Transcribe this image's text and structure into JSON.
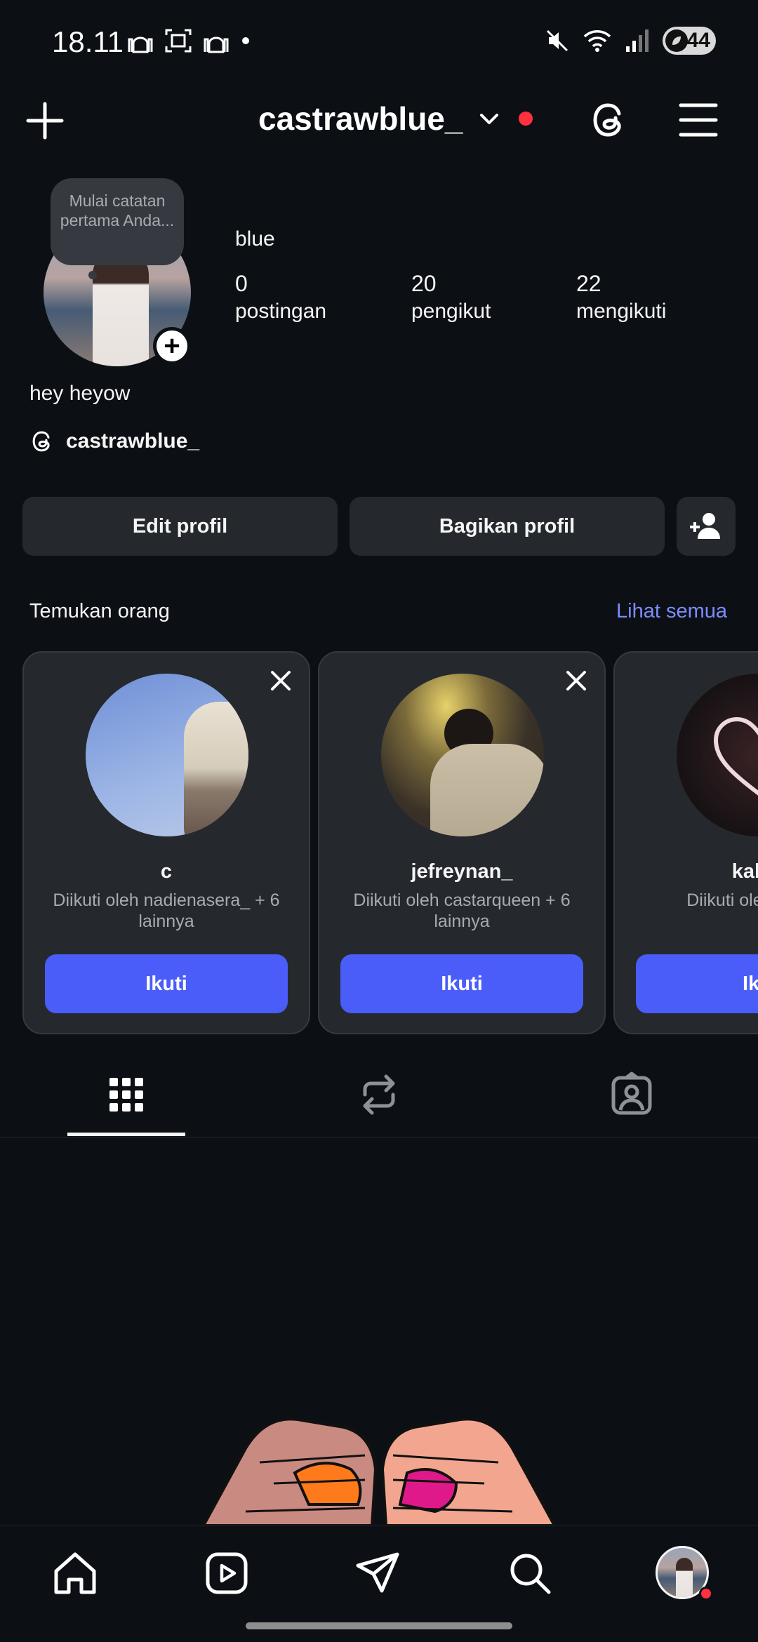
{
  "status_bar": {
    "time": "18.11",
    "battery": "44"
  },
  "header": {
    "username": "castrawblue_"
  },
  "profile": {
    "note": "Mulai catatan pertama Anda...",
    "display_name": "blue",
    "stats": [
      {
        "value": "0",
        "label": "postingan"
      },
      {
        "value": "20",
        "label": "pengikut"
      },
      {
        "value": "22",
        "label": "mengikuti"
      }
    ],
    "bio": "hey heyow",
    "threads_handle": "castrawblue_"
  },
  "actions": {
    "edit_label": "Edit profil",
    "share_label": "Bagikan profil"
  },
  "discover": {
    "title": "Temukan orang",
    "see_all": "Lihat semua",
    "cards": [
      {
        "name": "c",
        "subtitle": "Diikuti oleh nadienasera_ + 6 lainnya",
        "follow_label": "Ikuti"
      },
      {
        "name": "jefreynan_",
        "subtitle": "Diikuti oleh castarqueen + 6 lainnya",
        "follow_label": "Ikuti"
      },
      {
        "name": "kalea",
        "subtitle": "Diikuti oleh ca lain",
        "follow_label": "Iku"
      }
    ]
  },
  "tabs": [
    {
      "icon": "grid-icon",
      "active": true
    },
    {
      "icon": "reposts-icon",
      "active": false
    },
    {
      "icon": "tagged-icon",
      "active": false
    }
  ],
  "bottom_nav": [
    "home-icon",
    "reels-icon",
    "messages-icon",
    "search-icon",
    "profile-avatar"
  ],
  "colors": {
    "background": "#0c1014",
    "button": "#25292e",
    "accent": "#4a5df9",
    "link": "#7b8dff",
    "notification": "#ff3040"
  }
}
